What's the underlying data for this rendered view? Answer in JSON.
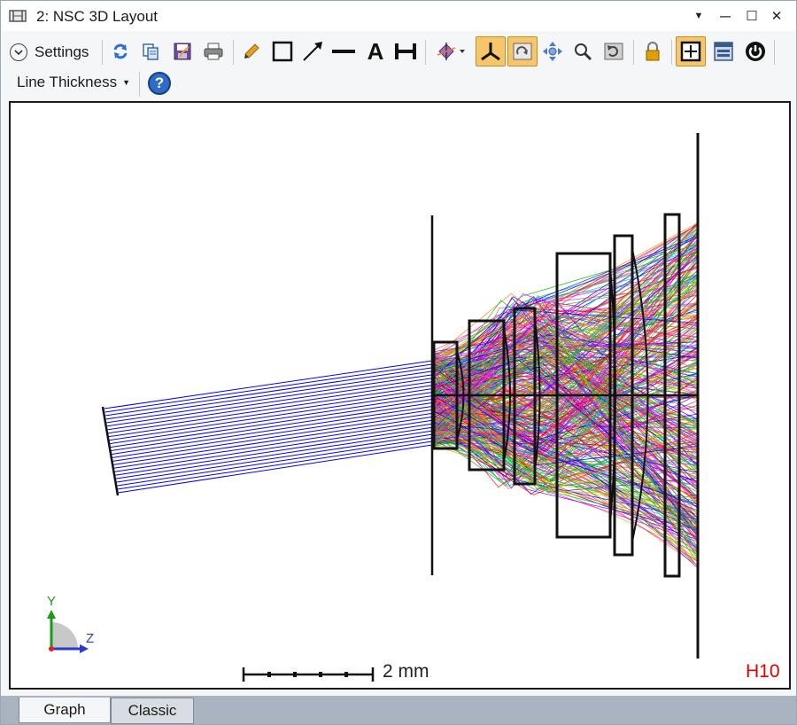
{
  "window": {
    "title": "2: NSC 3D Layout"
  },
  "titlebar_controls": {
    "dropdown": "▼",
    "minimize": "—",
    "maximize": "☐",
    "close": "✕"
  },
  "toolbar": {
    "settings_label": "Settings",
    "line_thickness_label": "Line Thickness",
    "help_label": "?",
    "text_tool_label": "A"
  },
  "plot": {
    "scale_label": "2 mm",
    "config_label": "H10",
    "axis_y_label": "Y",
    "axis_z_label": "Z"
  },
  "tabs": [
    {
      "label": "Graph"
    },
    {
      "label": "Classic"
    }
  ],
  "colors": {
    "ray_blue": "#0000ff",
    "config_label": "#e00000",
    "active_button": "#f7c66a",
    "ray_palette": [
      "#ff0000",
      "#00c000",
      "#0000ff",
      "#ff00ff",
      "#00c8c8",
      "#c8c800",
      "#ff8000",
      "#8000ff",
      "#40a040",
      "#e05090"
    ]
  },
  "icons": [
    "refresh-icon",
    "copy-icon",
    "save-icon",
    "print-icon",
    "pencil-icon",
    "rectangle-icon",
    "arrow-icon",
    "line-icon",
    "text-icon",
    "dimension-icon",
    "rotate-axes-icon",
    "axes-icon",
    "rotate-view-icon",
    "pan-icon",
    "zoom-icon",
    "reset-view-icon",
    "lock-icon",
    "fit-icon",
    "window-icon",
    "stop-icon"
  ]
}
